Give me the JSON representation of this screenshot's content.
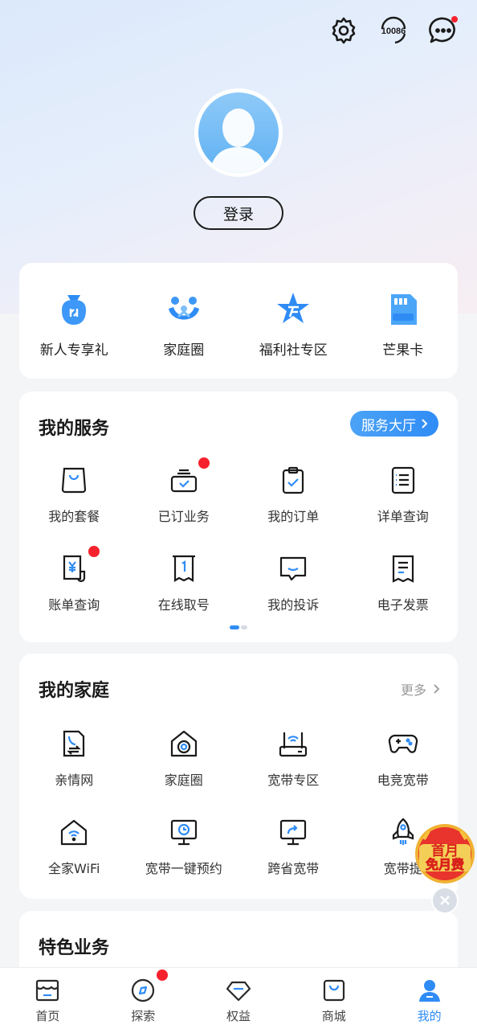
{
  "header": {
    "icons": [
      "settings-icon",
      "hotline-10086-icon",
      "messages-icon"
    ],
    "hotline_text": "10086"
  },
  "profile": {
    "login_label": "登录"
  },
  "quick_links": [
    {
      "label": "新人专享礼",
      "icon": "gift-bag-icon"
    },
    {
      "label": "家庭圈",
      "icon": "family-icon"
    },
    {
      "label": "福利社专区",
      "icon": "star-welfare-icon"
    },
    {
      "label": "芒果卡",
      "icon": "sim-card-icon"
    }
  ],
  "services": {
    "title": "我的服务",
    "hall_label": "服务大厅",
    "items": [
      {
        "label": "我的套餐",
        "icon": "bag-icon",
        "badge": false
      },
      {
        "label": "已订业务",
        "icon": "subscribed-icon",
        "badge": true
      },
      {
        "label": "我的订单",
        "icon": "clipboard-check-icon",
        "badge": false
      },
      {
        "label": "详单查询",
        "icon": "list-doc-icon",
        "badge": false
      },
      {
        "label": "账单查询",
        "icon": "bill-yuan-icon",
        "badge": true
      },
      {
        "label": "在线取号",
        "icon": "ticket-number-icon",
        "badge": false
      },
      {
        "label": "我的投诉",
        "icon": "complaint-icon",
        "badge": false
      },
      {
        "label": "电子发票",
        "icon": "invoice-icon",
        "badge": false
      }
    ]
  },
  "family": {
    "title": "我的家庭",
    "more_label": "更多",
    "items": [
      {
        "label": "亲情网",
        "icon": "phone-transfer-icon"
      },
      {
        "label": "家庭圈",
        "icon": "home-camera-icon"
      },
      {
        "label": "宽带专区",
        "icon": "router-icon"
      },
      {
        "label": "电竞宽带",
        "icon": "gamepad-icon"
      },
      {
        "label": "全家WiFi",
        "icon": "home-wifi-icon"
      },
      {
        "label": "宽带一键预约",
        "icon": "monitor-clock-icon"
      },
      {
        "label": "跨省宽带",
        "icon": "monitor-share-icon"
      },
      {
        "label": "宽带提",
        "icon": "rocket-icon"
      }
    ]
  },
  "featured": {
    "title": "特色业务"
  },
  "promo": {
    "line1": "首月",
    "line2": "免月费"
  },
  "tabbar": {
    "active_index": 4,
    "items": [
      {
        "label": "首页",
        "icon": "home-store-icon",
        "badge": false
      },
      {
        "label": "探索",
        "icon": "compass-icon",
        "badge": true
      },
      {
        "label": "权益",
        "icon": "diamond-icon",
        "badge": false
      },
      {
        "label": "商城",
        "icon": "shopping-bag-icon",
        "badge": false
      },
      {
        "label": "我的",
        "icon": "user-icon",
        "badge": false
      }
    ]
  },
  "colors": {
    "accent": "#2f8cf5",
    "badge_red": "#f5222d"
  }
}
